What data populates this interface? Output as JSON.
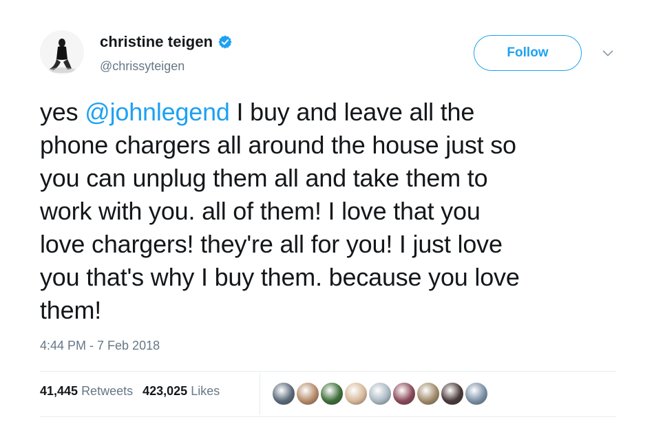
{
  "author": {
    "display_name": "christine teigen",
    "handle": "@chrissyteigen",
    "verified": true
  },
  "actions": {
    "follow_label": "Follow"
  },
  "tweet": {
    "lines": [
      {
        "mention": "@johnlegend",
        "prefix": "yes ",
        "rest": " I buy and leave all the"
      },
      "phone chargers all around the house just so",
      "you can unplug them all and take them to",
      "work with you. all of them! I love that you",
      "love chargers! they're all for you! I just love",
      "you that's why I buy them. because you love",
      "them!"
    ],
    "timestamp": "4:44 PM - 7 Feb 2018"
  },
  "stats": {
    "retweets_count": "41,445",
    "retweets_label": "Retweets",
    "likes_count": "423,025",
    "likes_label": "Likes"
  },
  "likers": [
    {
      "color": "#5b6a7a"
    },
    {
      "color": "#b58a6a"
    },
    {
      "color": "#3f6e3a"
    },
    {
      "color": "#d7b89a"
    },
    {
      "color": "#aab8c2"
    },
    {
      "color": "#8a4a5a"
    },
    {
      "color": "#a08a6a"
    },
    {
      "color": "#4a3a3a"
    },
    {
      "color": "#7a8fa6"
    }
  ],
  "colors": {
    "accent": "#1da1f2",
    "text": "#14171a",
    "secondary": "#657786"
  },
  "icons": {
    "verified": "verified-badge-icon",
    "caret": "chevron-down-icon"
  }
}
